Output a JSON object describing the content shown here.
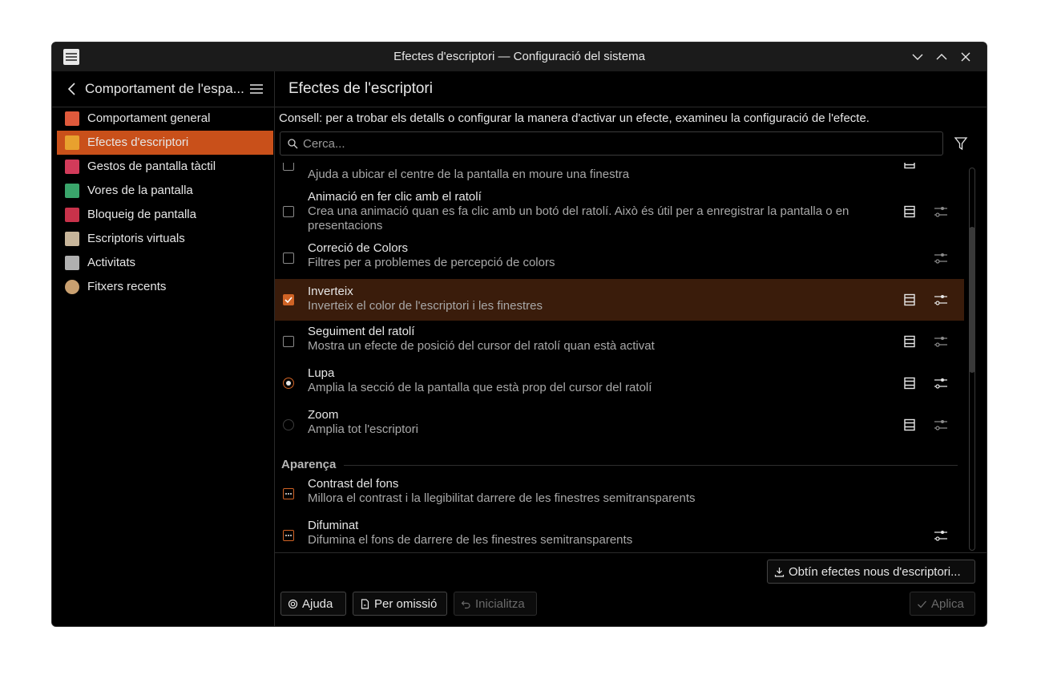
{
  "window": {
    "title": "Efectes d'escriptori — Configuració del sistema"
  },
  "sidebar": {
    "title": "Comportament de l'espa...",
    "items": [
      {
        "label": "Comportament general",
        "color": "#e05a3c"
      },
      {
        "label": "Efectes d'escriptori",
        "color": "#e8a12e",
        "active": true
      },
      {
        "label": "Gestos de pantalla tàctil",
        "color": "#d23b5a"
      },
      {
        "label": "Vores de la pantalla",
        "color": "#3aa56b"
      },
      {
        "label": "Bloqueig de pantalla",
        "color": "#c8324a"
      },
      {
        "label": "Escriptoris virtuals",
        "color": "#c7b59a"
      },
      {
        "label": "Activitats",
        "color": "#b0b0b0"
      },
      {
        "label": "Fitxers recents",
        "color": "#c9a070"
      }
    ]
  },
  "main": {
    "title": "Efectes de l'escriptori",
    "hint": "Consell: per a trobar els detalls o configurar la manera d'activar un efecte, examineu la configuració de l'efecte.",
    "search_placeholder": "Cerca...",
    "effects": [
      {
        "name": "",
        "desc": "Ajuda a ubicar el centre de la pantalla en moure una finestra",
        "control": "checkbox",
        "checked": false
      },
      {
        "name": "Animació en fer clic amb el ratolí",
        "desc": "Crea una animació quan es fa clic amb un botó del ratolí. Això és útil per a enregistrar la pantalla o en presentacions",
        "control": "checkbox",
        "checked": false
      },
      {
        "name": "Correció de Colors",
        "desc": "Filtres per a problemes de percepció de colors",
        "control": "checkbox",
        "checked": false
      },
      {
        "name": "Inverteix",
        "desc": "Inverteix el color de l'escriptori i les finestres",
        "control": "checkbox",
        "checked": true
      },
      {
        "name": "Seguiment del ratolí",
        "desc": "Mostra un efecte de posició del cursor del ratolí quan està activat",
        "control": "checkbox",
        "checked": false
      },
      {
        "name": "Lupa",
        "desc": "Amplia la secció de la pantalla que està prop del cursor del ratolí",
        "control": "radio",
        "checked": true
      },
      {
        "name": "Zoom",
        "desc": "Amplia tot l'escriptori",
        "control": "radio",
        "checked": false
      }
    ],
    "section_appearance": "Aparença",
    "appearance_effects": [
      {
        "name": "Contrast del fons",
        "desc": "Millora el contrast i la llegibilitat darrere de les finestres semitransparents"
      },
      {
        "name": "Difuminat",
        "desc": "Difumina el fons de darrere de les finestres semitransparents"
      }
    ]
  },
  "buttons": {
    "get_new": "Obtín efectes nous d'escriptori...",
    "help": "Ajuda",
    "defaults": "Per omissió",
    "reset": "Inicialitza",
    "apply": "Aplica"
  },
  "colors": {
    "accent": "#c9501a",
    "selected_row": "#3a1c0b"
  }
}
